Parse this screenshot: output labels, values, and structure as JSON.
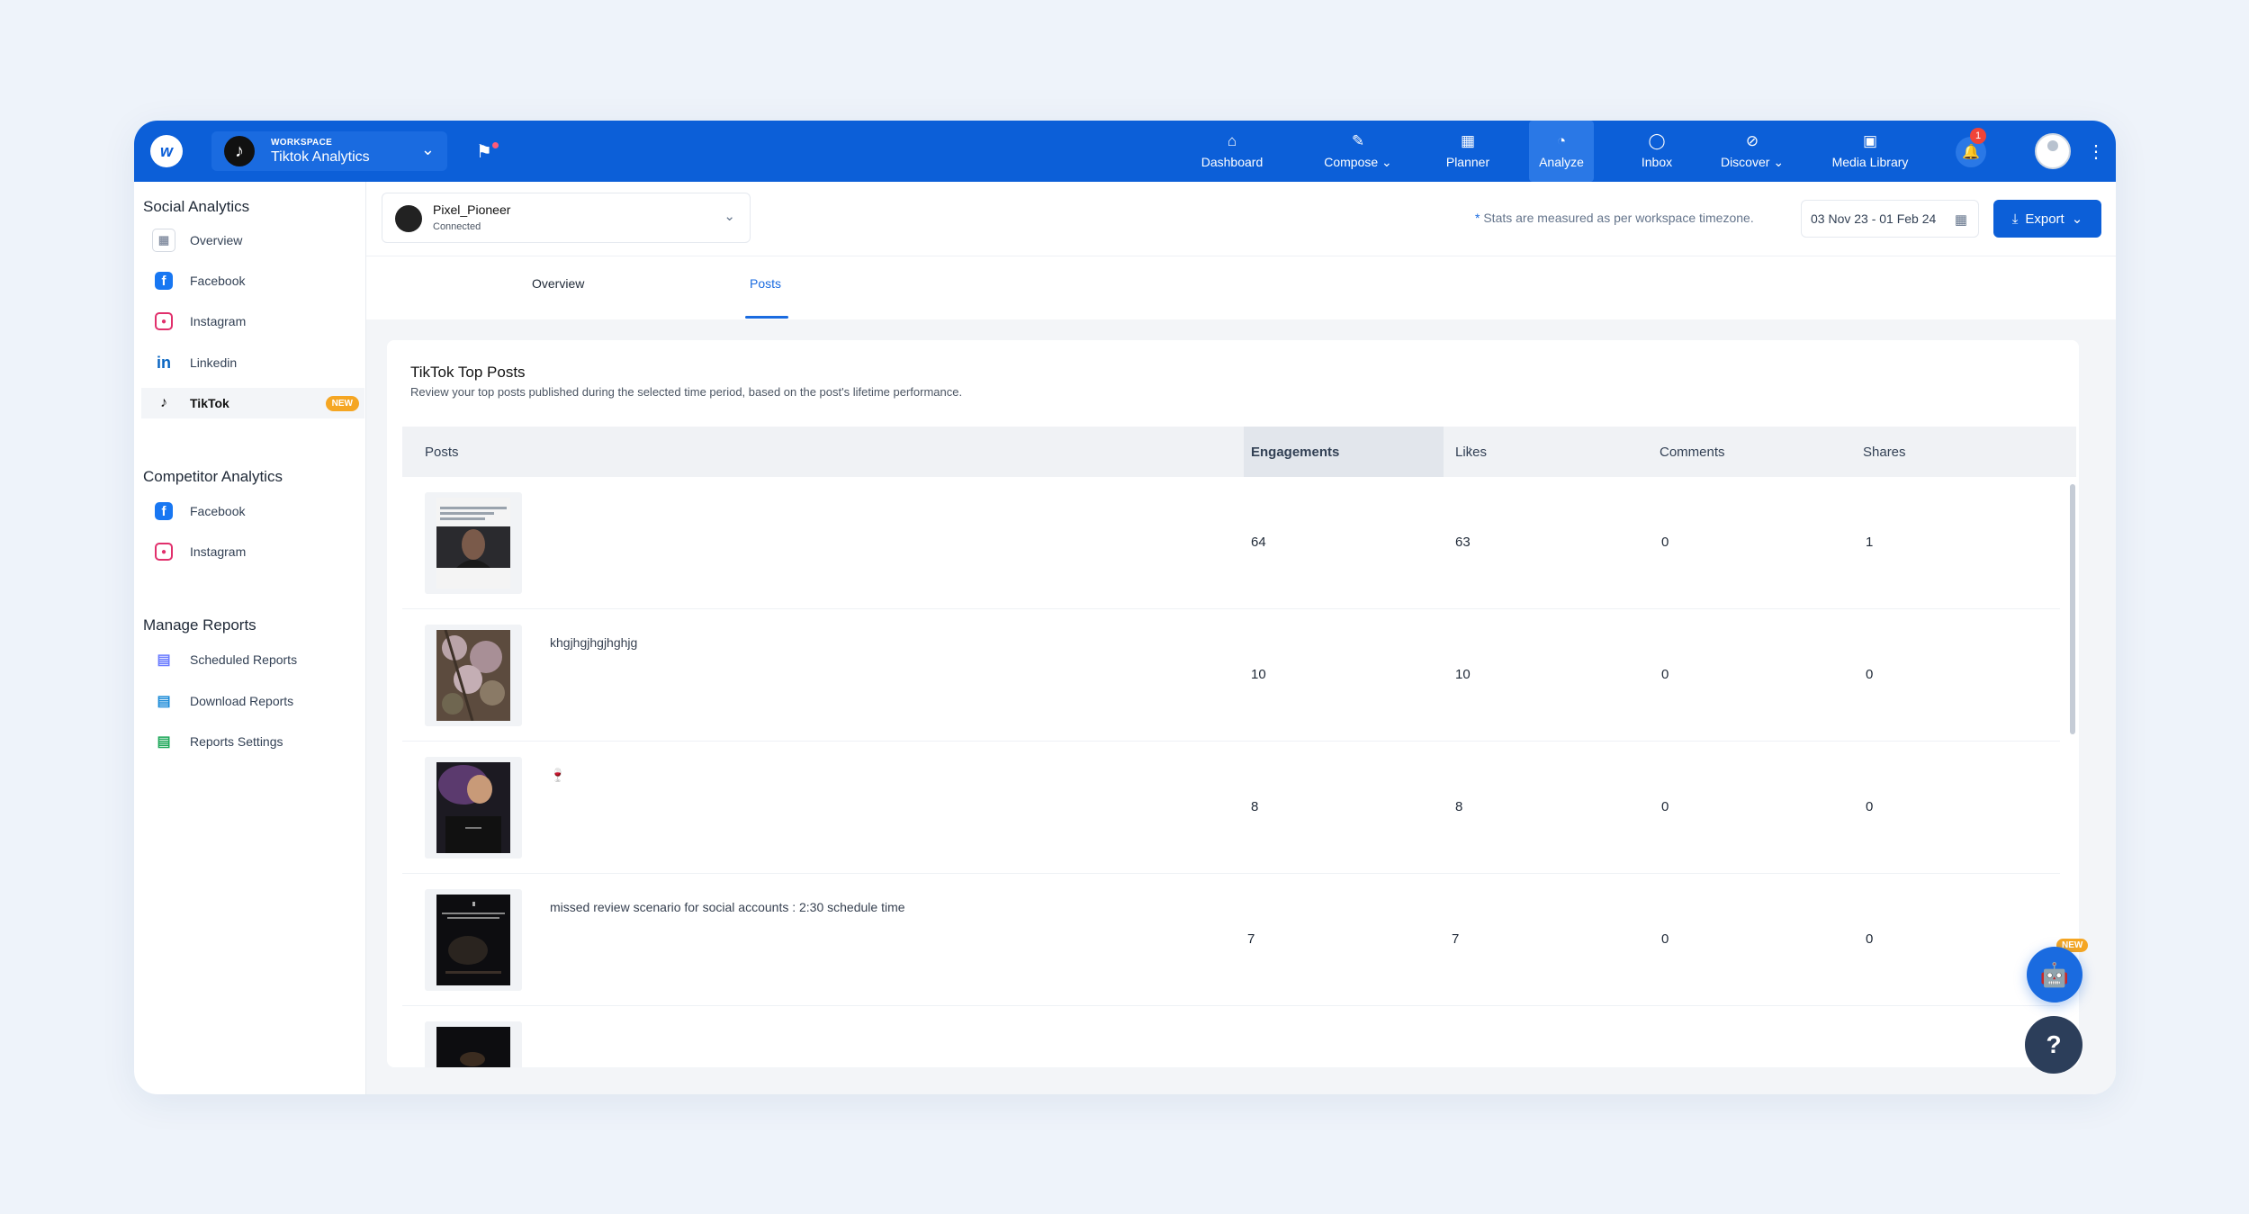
{
  "topbar": {
    "workspace_kicker": "WORKSPACE",
    "workspace_name": "Tiktok Analytics",
    "nav": [
      {
        "label": "Dashboard",
        "icon": "home-icon"
      },
      {
        "label": "Compose",
        "icon": "pencil-icon"
      },
      {
        "label": "Planner",
        "icon": "calendar-icon"
      },
      {
        "label": "Analyze",
        "icon": "pie-chart-icon"
      },
      {
        "label": "Inbox",
        "icon": "chat-icon"
      },
      {
        "label": "Discover",
        "icon": "compass-icon"
      },
      {
        "label": "Media Library",
        "icon": "media-icon"
      }
    ],
    "notification_count": "1"
  },
  "sidebar": {
    "social_heading": "Social Analytics",
    "social_items": [
      {
        "label": "Overview"
      },
      {
        "label": "Facebook"
      },
      {
        "label": "Instagram"
      },
      {
        "label": "Linkedin"
      },
      {
        "label": "TikTok",
        "badge": "NEW"
      }
    ],
    "competitor_heading": "Competitor Analytics",
    "competitor_items": [
      {
        "label": "Facebook"
      },
      {
        "label": "Instagram"
      }
    ],
    "reports_heading": "Manage Reports",
    "reports_items": [
      {
        "label": "Scheduled Reports"
      },
      {
        "label": "Download Reports"
      },
      {
        "label": "Reports Settings"
      }
    ]
  },
  "account": {
    "name": "Pixel_Pioneer",
    "status": "Connected"
  },
  "header": {
    "tz_asterisk": "*",
    "tz_note": "Stats are measured as per workspace timezone.",
    "date_range": "03 Nov 23 - 01 Feb 24",
    "export_label": "Export"
  },
  "tabs": [
    {
      "label": "Overview"
    },
    {
      "label": "Posts"
    }
  ],
  "card": {
    "title": "TikTok Top Posts",
    "subtitle": "Review your top posts published during the selected time period, based on the post's lifetime performance."
  },
  "table": {
    "columns": [
      "Posts",
      "Engagements",
      "Likes",
      "Comments",
      "Shares"
    ],
    "rows": [
      {
        "caption": "",
        "engagements": "64",
        "likes": "63",
        "comments": "0",
        "shares": "1"
      },
      {
        "caption": "khgjhgjhgjhghjg",
        "engagements": "10",
        "likes": "10",
        "comments": "0",
        "shares": "0"
      },
      {
        "caption": "🍷",
        "engagements": "8",
        "likes": "8",
        "comments": "0",
        "shares": "0"
      },
      {
        "caption": "missed review scenario for social accounts : 2:30 schedule time",
        "engagements": "7",
        "likes": "7",
        "comments": "0",
        "shares": "0"
      },
      {
        "caption": "",
        "engagements": "",
        "likes": "",
        "comments": "",
        "shares": ""
      }
    ]
  },
  "widgets": {
    "bot_badge": "NEW",
    "help_label": "?"
  }
}
